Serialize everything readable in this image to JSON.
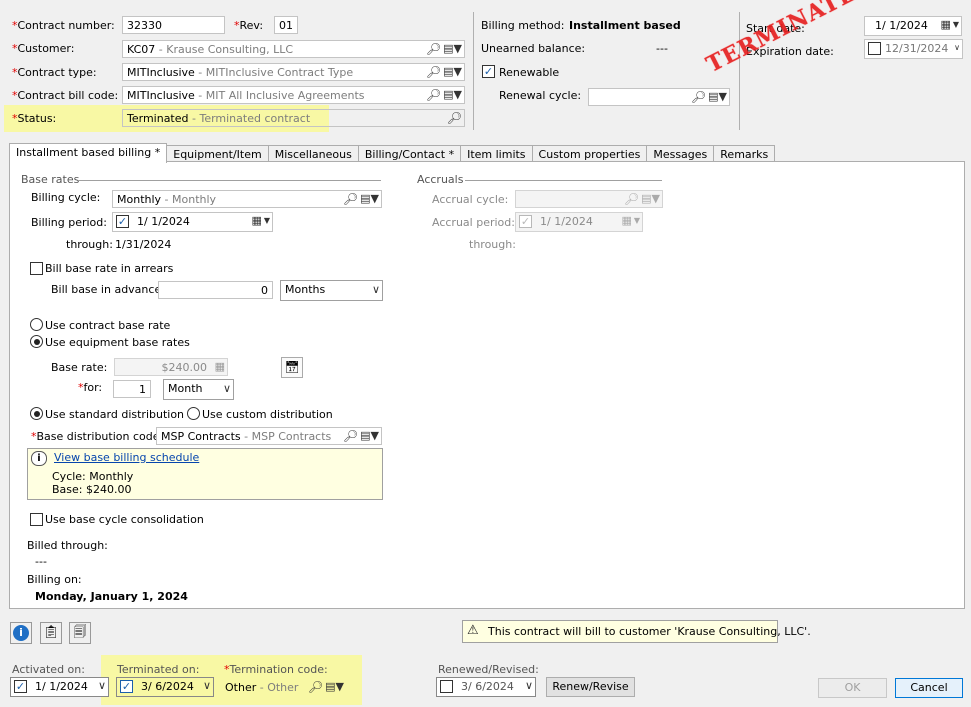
{
  "header": {
    "contract_number_label": "Contract number:",
    "contract_number": "32330",
    "rev_label": "Rev:",
    "rev": "01",
    "customer_label": "Customer:",
    "customer_code": "KC07",
    "customer_desc": " - Krause Consulting, LLC",
    "contract_type_label": "Contract type:",
    "contract_type_code": "MITInclusive",
    "contract_type_desc": " - MITInclusive Contract Type",
    "bill_code_label": "Contract bill code:",
    "bill_code": "MITInclusive",
    "bill_code_desc": " - MIT All Inclusive Agreements",
    "status_label": "Status:",
    "status_code": "Terminated",
    "status_desc": " - Terminated contract",
    "billing_method_label": "Billing method:",
    "billing_method": "Installment based",
    "unearned_label": "Unearned balance:",
    "unearned_value": "---",
    "renewable_label": "Renewable",
    "renewal_cycle_label": "Renewal cycle:",
    "start_date_label": "Start date:",
    "start_date": "1/  1/2024",
    "expiration_label": "Expiration date:",
    "expiration_date": "12/31/2024",
    "stamp": "TERMINATED"
  },
  "tabs": [
    {
      "label": "Installment based billing *"
    },
    {
      "label": "Equipment/Item"
    },
    {
      "label": "Miscellaneous"
    },
    {
      "label": "Billing/Contact *"
    },
    {
      "label": "Item limits"
    },
    {
      "label": "Custom properties"
    },
    {
      "label": "Messages"
    },
    {
      "label": "Remarks"
    }
  ],
  "base_rates": {
    "title": "Base rates",
    "billing_cycle_label": "Billing cycle:",
    "billing_cycle": "Monthly",
    "billing_cycle_desc": " - Monthly",
    "billing_period_label": "Billing period:",
    "billing_period": "1/  1/2024",
    "through_label": "through:",
    "through_value": "1/31/2024",
    "arrears_label": "Bill base rate in arrears",
    "advance_label": "Bill base in advance:",
    "advance_value": "0",
    "advance_unit": "Months",
    "use_contract_label": "Use contract base rate",
    "use_equipment_label": "Use equipment base rates",
    "base_rate_label": "Base rate:",
    "base_rate_value": "$240.00",
    "for_label": "for:",
    "for_value": "1",
    "for_unit": "Month",
    "standard_dist_label": "Use standard distribution",
    "custom_dist_label": "Use custom distribution",
    "base_dist_label": "Base distribution code:",
    "base_dist_code": "MSP Contracts",
    "base_dist_desc": " - MSP Contracts",
    "schedule_link": "View base billing schedule",
    "schedule_cycle": "Cycle: Monthly",
    "schedule_base": "Base: $240.00",
    "consolidation_label": "Use base cycle consolidation",
    "billed_through_label": "Billed through:",
    "billed_through_value": "---",
    "billing_on_label": "Billing on:",
    "billing_on_value": "Monday, January 1, 2024"
  },
  "accruals": {
    "title": "Accruals",
    "accrual_cycle_label": "Accrual cycle:",
    "accrual_period_label": "Accrual period:",
    "accrual_period": "1/  1/2024",
    "through_label": "through:"
  },
  "footer": {
    "notice": "This contract will bill to customer 'Krause Consulting, LLC'.",
    "activated_label": "Activated on:",
    "activated_date": "1/  1/2024",
    "terminated_label": "Terminated on:",
    "terminated_date": "3/  6/2024",
    "termination_code_label": "Termination code:",
    "termination_code": "Other",
    "termination_code_desc": " - Other",
    "renewed_label": "Renewed/Revised:",
    "renewed_date": "3/  6/2024",
    "renew_button": "Renew/Revise",
    "ok_button": "OK",
    "cancel_button": "Cancel"
  },
  "icons": {
    "lookup": "magnifier-icon",
    "detail": "page-dropdown-icon",
    "calendar": "calendar-icon",
    "info": "info-icon",
    "warning": "warning-icon"
  },
  "colors": {
    "highlight": "#ffff66",
    "stamp": "#e62020",
    "link": "#0645ad",
    "required": "#e00000"
  }
}
